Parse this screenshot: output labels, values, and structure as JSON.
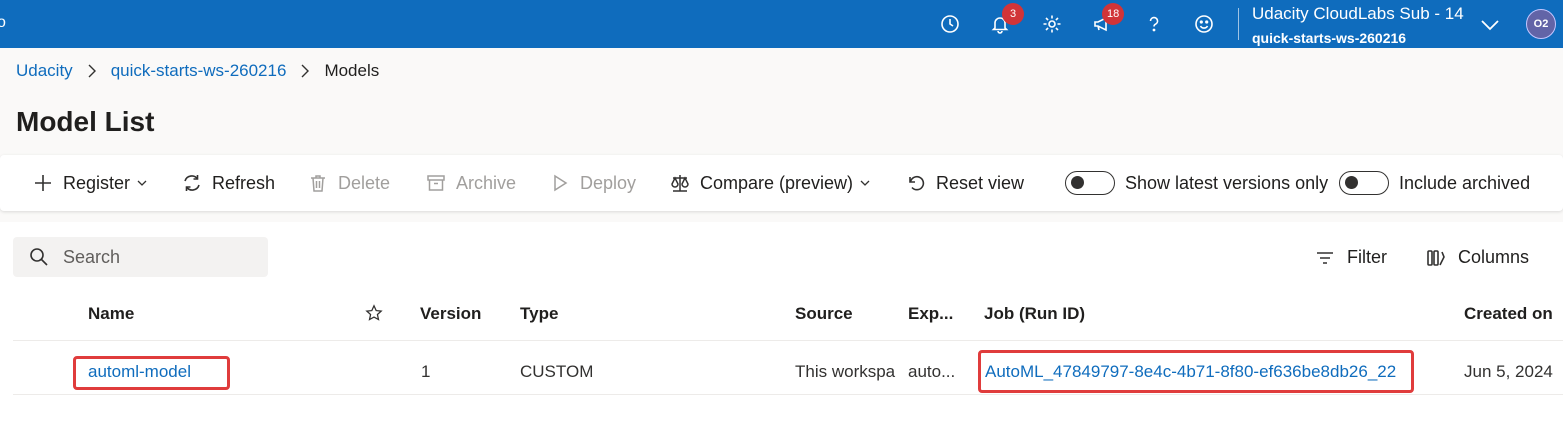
{
  "topbar": {
    "left_glyph": "o",
    "notifications_count": "3",
    "announcements_count": "18",
    "account": {
      "subscription": "Udacity CloudLabs Sub - 14",
      "workspace": "quick-starts-ws-260216",
      "avatar_initials": "O2"
    },
    "icons": [
      "history-icon",
      "bell-icon",
      "gear-icon",
      "megaphone-icon",
      "help-icon",
      "smiley-icon",
      "chevron-down-icon"
    ],
    "colors": {
      "bar": "#0f6cbd",
      "badge": "#d13438",
      "avatar": "#6264a7"
    }
  },
  "breadcrumb": {
    "items": [
      "Udacity",
      "quick-starts-ws-260216"
    ],
    "current": "Models"
  },
  "page_title": "Model List",
  "toolbar": {
    "register": "Register",
    "refresh": "Refresh",
    "delete": "Delete",
    "archive": "Archive",
    "deploy": "Deploy",
    "compare": "Compare (preview)",
    "reset_view": "Reset view",
    "show_latest_toggle": "Show latest versions only",
    "include_archived_toggle": "Include archived"
  },
  "list": {
    "search_placeholder": "Search",
    "filter": "Filter",
    "columns": "Columns",
    "headers": {
      "name": "Name",
      "version": "Version",
      "type": "Type",
      "source": "Source",
      "experiment": "Exp...",
      "job": "Job (Run ID)",
      "created_on": "Created on"
    },
    "rows": [
      {
        "name": "automl-model",
        "version": "1",
        "type": "CUSTOM",
        "source": "This workspa",
        "experiment": "auto...",
        "job": "AutoML_47849797-8e4c-4b71-8f80-ef636be8db26_22",
        "created_on": "Jun 5, 2024"
      }
    ]
  },
  "highlight_color": "#e03c3c"
}
